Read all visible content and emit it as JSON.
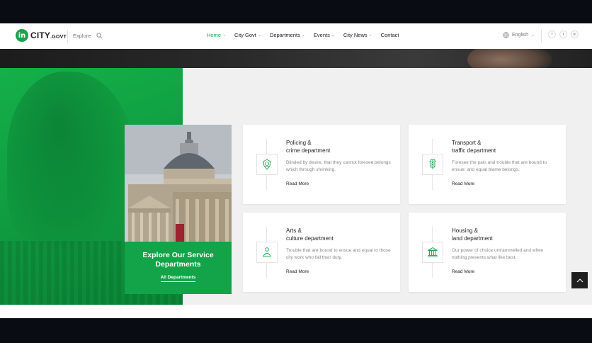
{
  "header": {
    "logo_mark": "in",
    "logo_text": "CITY",
    "logo_suffix": ".GOVT",
    "explore_label": "Explore",
    "nav": [
      {
        "label": "Home"
      },
      {
        "label": "City Govt"
      },
      {
        "label": "Departments"
      },
      {
        "label": "Events"
      },
      {
        "label": "City News"
      },
      {
        "label": "Contact"
      }
    ],
    "language": "English",
    "social": {
      "facebook": "f",
      "twitter": "t",
      "linkedin": "in"
    }
  },
  "feature": {
    "title": "Explore Our Service Departments",
    "link": "All Departments"
  },
  "cards": [
    {
      "title_line1": "Policing &",
      "title_line2": "crime department",
      "desc": "Blinded by desire, that they cannot foresee belongs which through shrinking.",
      "link": "Read More",
      "icon": "police-badge-icon"
    },
    {
      "title_line1": "Transport &",
      "title_line2": "traffic department",
      "desc": "Foresee the pain and trouble that are bound to ensue; and equal blame belongs.",
      "link": "Read More",
      "icon": "traffic-light-icon"
    },
    {
      "title_line1": "Arts &",
      "title_line2": "culture department",
      "desc": "Trouble that are bound to ensue and equal to those city work who fail their duty.",
      "link": "Read More",
      "icon": "artist-icon"
    },
    {
      "title_line1": "Housing &",
      "title_line2": "land department",
      "desc": "Our power of choice untrammelled and when nothing prevents what like best.",
      "link": "Read More",
      "icon": "building-icon"
    }
  ],
  "colors": {
    "accent": "#1aa34a",
    "panel_background": "#f0f0f0"
  }
}
